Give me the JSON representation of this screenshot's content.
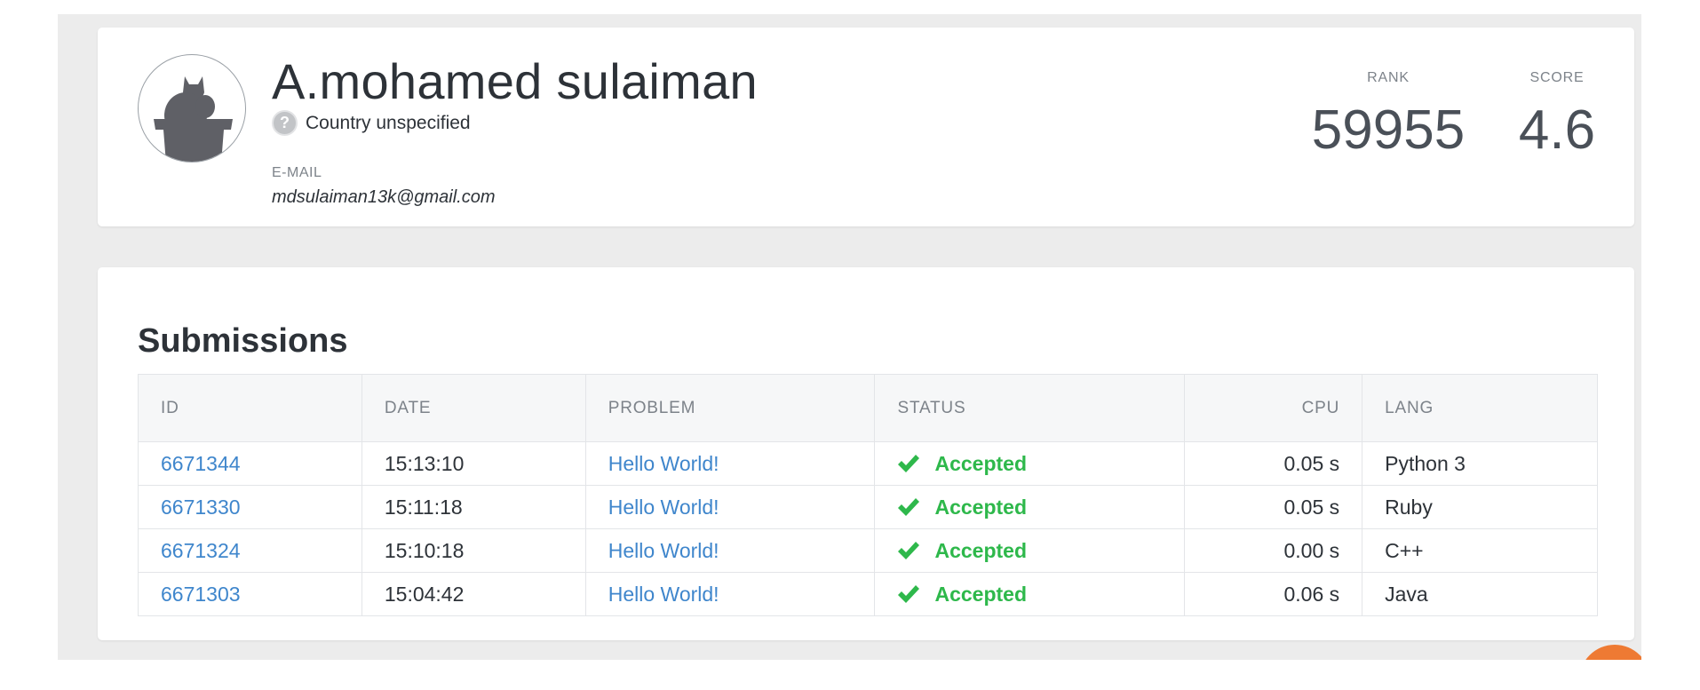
{
  "profile": {
    "name": "A.mohamed sulaiman",
    "country": "Country unspecified",
    "email_label": "E-MAIL",
    "email": "mdsulaiman13k@gmail.com",
    "rank_label": "RANK",
    "rank": "59955",
    "score_label": "SCORE",
    "score": "4.6"
  },
  "submissions": {
    "title": "Submissions",
    "columns": [
      "ID",
      "DATE",
      "PROBLEM",
      "STATUS",
      "CPU",
      "LANG"
    ],
    "rows": [
      {
        "id": "6671344",
        "date": "15:13:10",
        "problem": "Hello World!",
        "status": "Accepted",
        "cpu": "0.05 s",
        "lang": "Python 3"
      },
      {
        "id": "6671330",
        "date": "15:11:18",
        "problem": "Hello World!",
        "status": "Accepted",
        "cpu": "0.05 s",
        "lang": "Ruby"
      },
      {
        "id": "6671324",
        "date": "15:10:18",
        "problem": "Hello World!",
        "status": "Accepted",
        "cpu": "0.00 s",
        "lang": "C++"
      },
      {
        "id": "6671303",
        "date": "15:04:42",
        "problem": "Hello World!",
        "status": "Accepted",
        "cpu": "0.06 s",
        "lang": "Java"
      }
    ]
  },
  "colors": {
    "link": "#3f86cc",
    "accepted": "#2eb84b",
    "chat_button": "#ee7a33"
  },
  "icons": {
    "avatar": "cat-avatar-icon",
    "country": "question-mark-icon",
    "status": "checkmark-icon"
  }
}
